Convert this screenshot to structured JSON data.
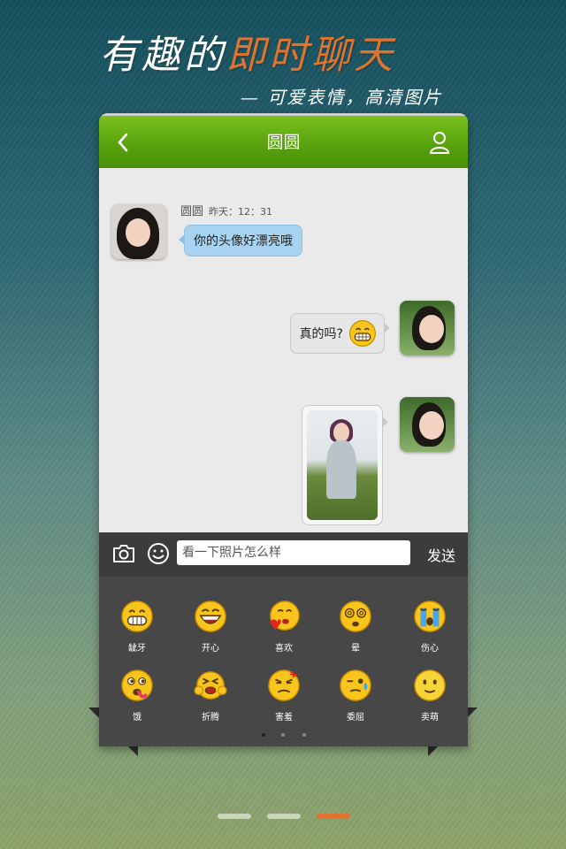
{
  "promo": {
    "title_part1": "有趣的",
    "title_part2": "即时聊天",
    "subtitle": "— 可爱表情，高清图片"
  },
  "header": {
    "title": "圆圆"
  },
  "messages": [
    {
      "sender": "圆圆",
      "time": "昨天：12：31",
      "text": "你的头像好漂亮哦",
      "direction": "incoming"
    },
    {
      "text": "真的吗?",
      "emoji": "grin-emoji-icon",
      "direction": "outgoing"
    },
    {
      "type": "photo",
      "direction": "outgoing"
    }
  ],
  "input": {
    "placeholder": "看一下照片怎么样",
    "send_label": "发送"
  },
  "emoticons": [
    {
      "label": "龇牙",
      "icon": "grin-emoji-icon"
    },
    {
      "label": "开心",
      "icon": "happy-emoji-icon"
    },
    {
      "label": "喜欢",
      "icon": "like-emoji-icon"
    },
    {
      "label": "晕",
      "icon": "dizzy-emoji-icon"
    },
    {
      "label": "伤心",
      "icon": "cry-emoji-icon"
    },
    {
      "label": "饿",
      "icon": "hungry-emoji-icon"
    },
    {
      "label": "折腾",
      "icon": "frustrated-emoji-icon"
    },
    {
      "label": "害羞",
      "icon": "shy-emoji-icon"
    },
    {
      "label": "委屈",
      "icon": "aggrieved-emoji-icon"
    },
    {
      "label": "卖萌",
      "icon": "cute-emoji-icon"
    }
  ],
  "emoticon_pages": {
    "count": 3,
    "active": 1
  },
  "screens": {
    "count": 3,
    "active": 3
  },
  "colors": {
    "accent": "#e0742e",
    "header_green": "#5aa30e",
    "incoming_bubble": "#a8d3f0",
    "emoji_yellow": "#f7c51c"
  }
}
